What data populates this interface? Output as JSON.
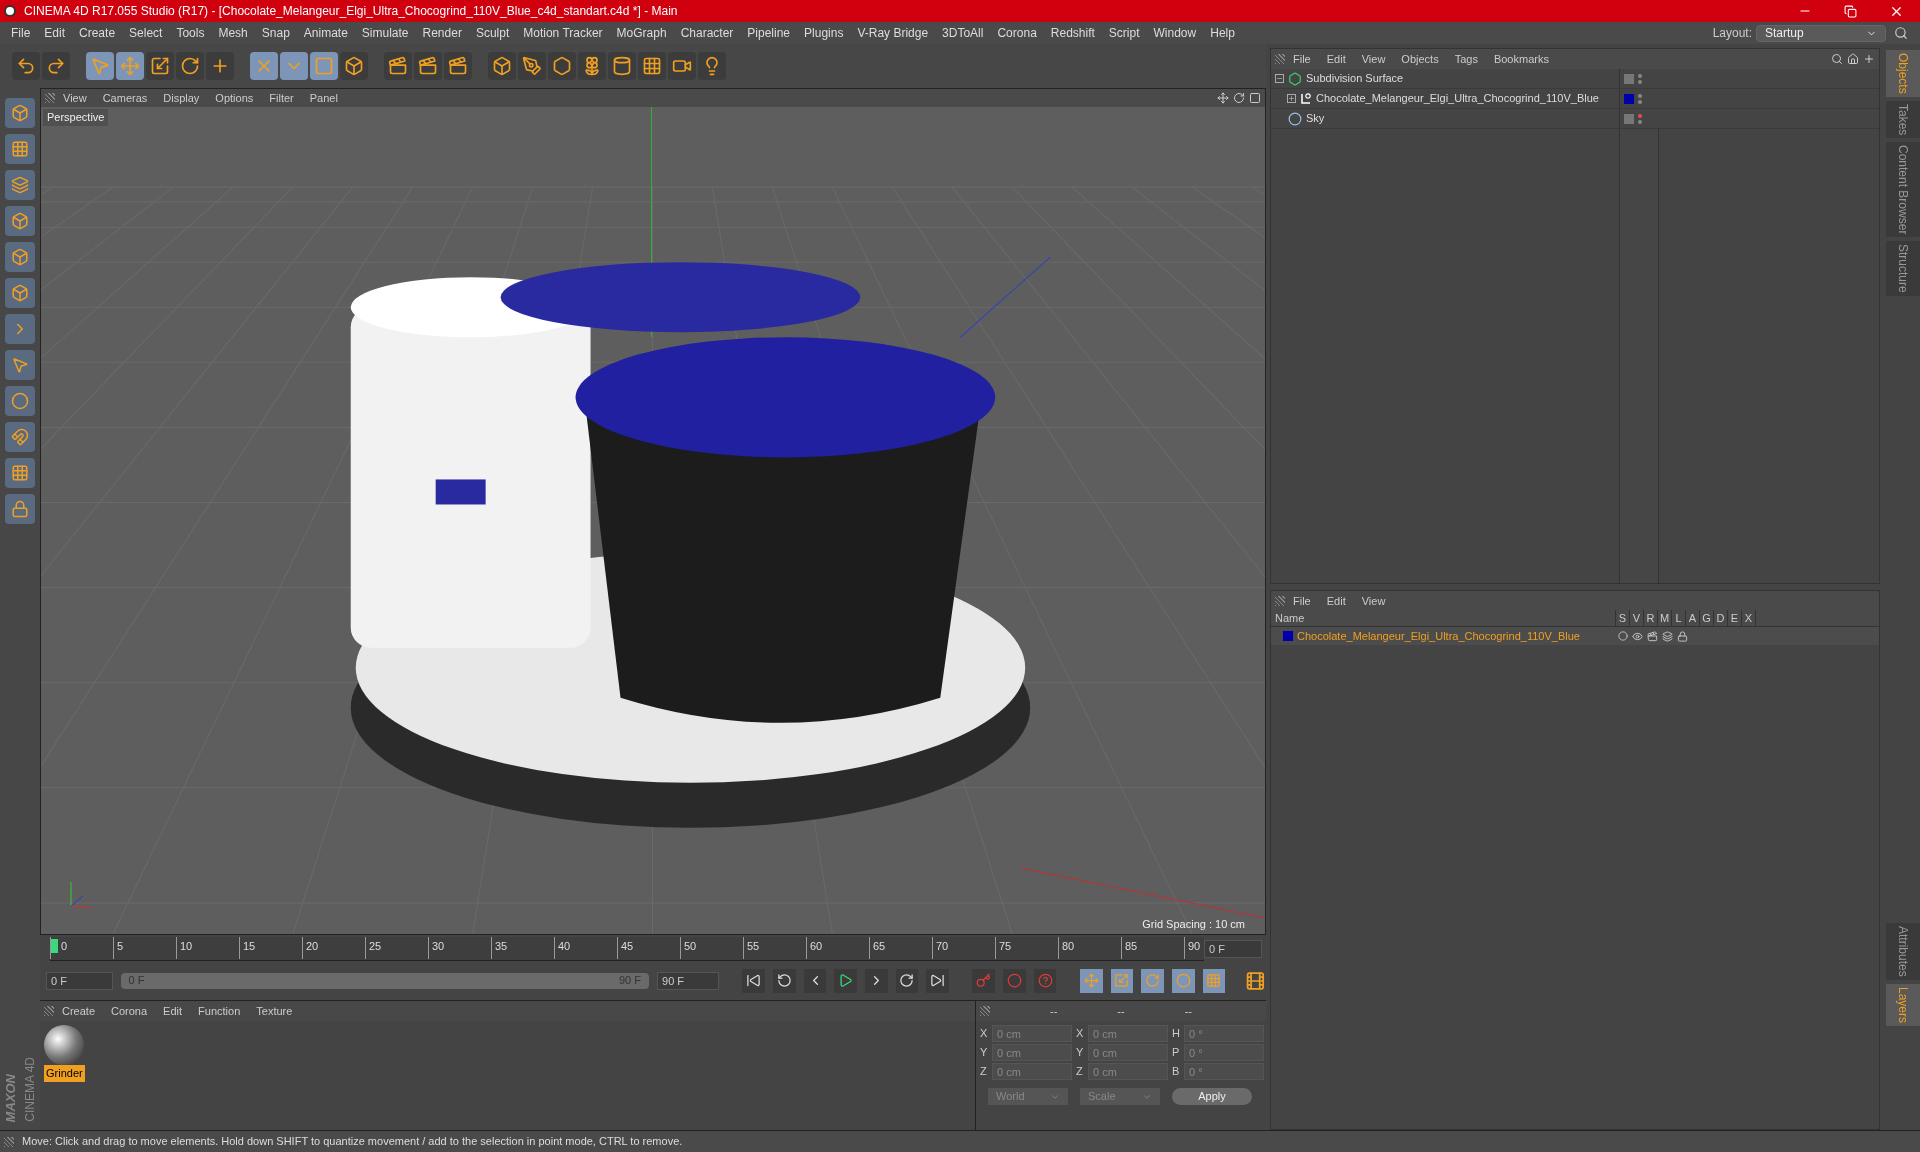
{
  "window": {
    "title": "CINEMA 4D R17.055 Studio (R17) - [Chocolate_Melangeur_Elgi_Ultra_Chocogrind_110V_Blue_c4d_standart.c4d *] - Main"
  },
  "menu": [
    "File",
    "Edit",
    "Create",
    "Select",
    "Tools",
    "Mesh",
    "Snap",
    "Animate",
    "Simulate",
    "Render",
    "Sculpt",
    "Motion Tracker",
    "MoGraph",
    "Character",
    "Pipeline",
    "Plugins",
    "V-Ray Bridge",
    "3DToAll",
    "Corona",
    "Redshift",
    "Script",
    "Window",
    "Help"
  ],
  "layout": {
    "label": "Layout:",
    "value": "Startup"
  },
  "viewport": {
    "menu": [
      "View",
      "Cameras",
      "Display",
      "Options",
      "Filter",
      "Panel"
    ],
    "camera": "Perspective",
    "grid_spacing": "Grid Spacing : 10 cm"
  },
  "object_manager": {
    "menu": [
      "File",
      "Edit",
      "View",
      "Objects",
      "Tags",
      "Bookmarks"
    ],
    "objects": [
      {
        "name": "Subdivision Surface",
        "kind": "subdivision",
        "expanded": true,
        "children": [
          {
            "name": "Chocolate_Melangeur_Elgi_Ultra_Chocogrind_110V_Blue",
            "kind": "null",
            "expanded": false,
            "color": "#0000aa"
          }
        ]
      },
      {
        "name": "Sky",
        "kind": "sky"
      }
    ]
  },
  "layer_manager": {
    "menu": [
      "File",
      "Edit",
      "View"
    ],
    "columns": [
      "Name",
      "S",
      "V",
      "R",
      "M",
      "L",
      "A",
      "G",
      "D",
      "E",
      "X"
    ],
    "rows": [
      {
        "name": "Chocolate_Melangeur_Elgi_Ultra_Chocogrind_110V_Blue",
        "color": "#0000aa"
      }
    ]
  },
  "side_tabs_top": [
    {
      "label": "Objects",
      "selected": true
    },
    {
      "label": "Takes",
      "selected": false
    },
    {
      "label": "Content Browser",
      "selected": false
    },
    {
      "label": "Structure",
      "selected": false
    }
  ],
  "side_tabs_bottom": [
    {
      "label": "Attributes",
      "selected": false
    },
    {
      "label": "Layers",
      "selected": true
    }
  ],
  "timeline": {
    "level": 1,
    "ticks": [
      "0",
      "5",
      "10",
      "15",
      "20",
      "25",
      "30",
      "35",
      "40",
      "45",
      "50",
      "55",
      "60",
      "65",
      "70",
      "75",
      "80",
      "85",
      "90"
    ],
    "current_frame": "0 F",
    "start": "0 F",
    "range_start": "0 F",
    "range_end": "90 F",
    "end": "90 F"
  },
  "material_manager": {
    "menu": [
      "Create",
      "Corona",
      "Edit",
      "Function",
      "Texture"
    ],
    "materials": [
      {
        "name": "Grinder",
        "selected": true
      }
    ]
  },
  "coordinates": {
    "headers": [
      "--",
      "--",
      "--"
    ],
    "columns": [
      [
        {
          "axis": "X",
          "value": "0 cm"
        },
        {
          "axis": "Y",
          "value": "0 cm"
        },
        {
          "axis": "Z",
          "value": "0 cm"
        }
      ],
      [
        {
          "axis": "X",
          "value": "0 cm"
        },
        {
          "axis": "Y",
          "value": "0 cm"
        },
        {
          "axis": "Z",
          "value": "0 cm"
        }
      ],
      [
        {
          "axis": "H",
          "value": "0 °"
        },
        {
          "axis": "P",
          "value": "0 °"
        },
        {
          "axis": "B",
          "value": "0 °"
        }
      ]
    ],
    "space": "World",
    "mode": "Scale",
    "apply": "Apply",
    "disabled": true
  },
  "brand": {
    "top": "MAXON",
    "bottom": "CINEMA 4D"
  },
  "status_bar": "Move: Click and drag to move elements. Hold down SHIFT to quantize movement / add to the selection in point mode, CTRL to remove."
}
